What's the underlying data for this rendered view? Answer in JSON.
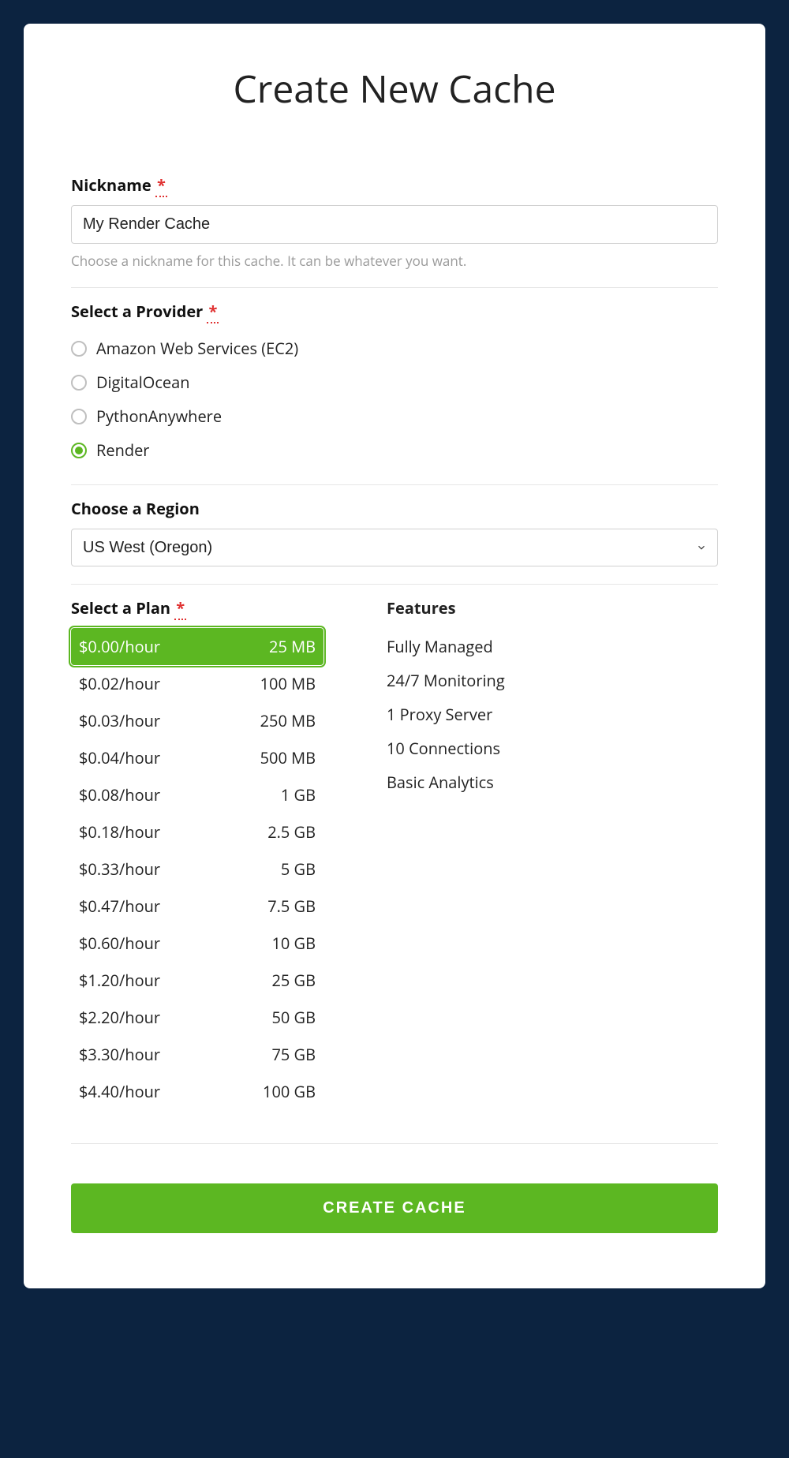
{
  "title": "Create New Cache",
  "nickname": {
    "label": "Nickname",
    "required_mark": "*",
    "value": "My Render Cache",
    "help": "Choose a nickname for this cache. It can be whatever you want."
  },
  "provider": {
    "label": "Select a Provider",
    "required_mark": "*",
    "options": [
      {
        "label": "Amazon Web Services (EC2)",
        "selected": false
      },
      {
        "label": "DigitalOcean",
        "selected": false
      },
      {
        "label": "PythonAnywhere",
        "selected": false
      },
      {
        "label": "Render",
        "selected": true
      }
    ]
  },
  "region": {
    "label": "Choose a Region",
    "selected": "US West (Oregon)"
  },
  "plan": {
    "label": "Select a Plan",
    "required_mark": "*",
    "options": [
      {
        "price": "$0.00/hour",
        "size": "25 MB",
        "selected": true
      },
      {
        "price": "$0.02/hour",
        "size": "100 MB",
        "selected": false
      },
      {
        "price": "$0.03/hour",
        "size": "250 MB",
        "selected": false
      },
      {
        "price": "$0.04/hour",
        "size": "500 MB",
        "selected": false
      },
      {
        "price": "$0.08/hour",
        "size": "1 GB",
        "selected": false
      },
      {
        "price": "$0.18/hour",
        "size": "2.5 GB",
        "selected": false
      },
      {
        "price": "$0.33/hour",
        "size": "5 GB",
        "selected": false
      },
      {
        "price": "$0.47/hour",
        "size": "7.5 GB",
        "selected": false
      },
      {
        "price": "$0.60/hour",
        "size": "10 GB",
        "selected": false
      },
      {
        "price": "$1.20/hour",
        "size": "25 GB",
        "selected": false
      },
      {
        "price": "$2.20/hour",
        "size": "50 GB",
        "selected": false
      },
      {
        "price": "$3.30/hour",
        "size": "75 GB",
        "selected": false
      },
      {
        "price": "$4.40/hour",
        "size": "100 GB",
        "selected": false
      }
    ]
  },
  "features": {
    "heading": "Features",
    "items": [
      "Fully Managed",
      "24/7 Monitoring",
      "1 Proxy Server",
      "10 Connections",
      "Basic Analytics"
    ]
  },
  "submit": {
    "label": "CREATE CACHE"
  }
}
